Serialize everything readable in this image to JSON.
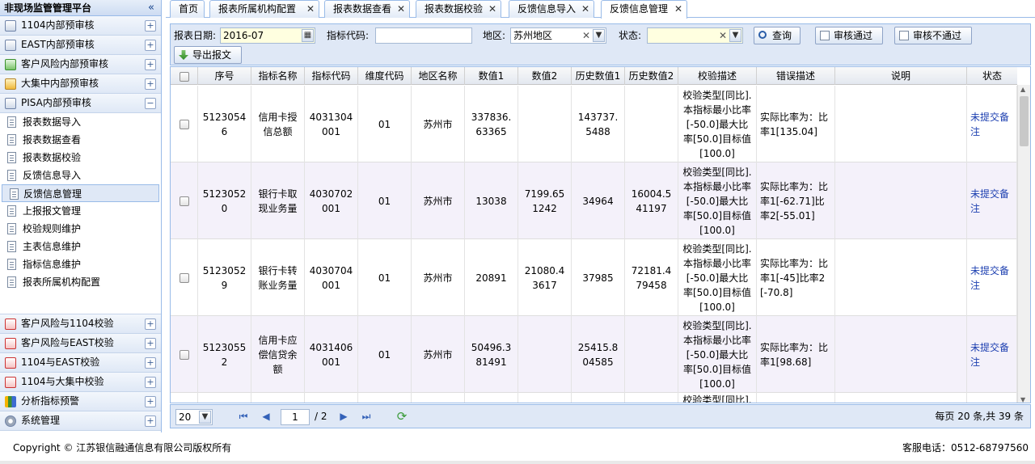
{
  "sidebar": {
    "title": "非现场监管管理平台",
    "collapse_glyph": "«",
    "groups_top": [
      {
        "label": "1104内部预审核",
        "icon": "doc-icon",
        "toggle": "+"
      },
      {
        "label": "EAST内部预审核",
        "icon": "doc-icon",
        "toggle": "+"
      },
      {
        "label": "客户风险内部预审核",
        "icon": "excel-icon",
        "toggle": "+"
      },
      {
        "label": "大集中内部预审核",
        "icon": "ribbon-icon",
        "toggle": "+"
      },
      {
        "label": "PISA内部预审核",
        "icon": "doc-icon",
        "toggle": "−"
      }
    ],
    "items": [
      {
        "label": "报表数据导入"
      },
      {
        "label": "报表数据查看"
      },
      {
        "label": "报表数据校验"
      },
      {
        "label": "反馈信息导入"
      },
      {
        "label": "反馈信息管理"
      },
      {
        "label": "上报报文管理"
      },
      {
        "label": "校验规则维护"
      },
      {
        "label": "主表信息维护"
      },
      {
        "label": "指标信息维护"
      },
      {
        "label": "报表所属机构配置"
      }
    ],
    "groups_bottom": [
      {
        "label": "客户风险与1104校验",
        "toggle": "+"
      },
      {
        "label": "客户风险与EAST校验",
        "toggle": "+"
      },
      {
        "label": "1104与EAST校验",
        "toggle": "+"
      },
      {
        "label": "1104与大集中校验",
        "toggle": "+"
      },
      {
        "label": "分析指标预警",
        "toggle": "+"
      },
      {
        "label": "系统管理",
        "toggle": "+"
      }
    ]
  },
  "tabs": [
    "首页",
    "报表所属机构配置",
    "报表数据查看",
    "报表数据校验",
    "反馈信息导入",
    "反馈信息管理"
  ],
  "tab_close": "✕",
  "filters": {
    "date_label": "报表日期:",
    "date_value": "2016-07",
    "code_label": "指标代码:",
    "code_value": "",
    "region_label": "地区:",
    "region_value": "苏州地区",
    "status_label": "状态:",
    "status_value": "",
    "clear_glyph": "✕",
    "dropdown_glyph": "▼",
    "calendar_glyph": "▦"
  },
  "buttons": {
    "query": "查询",
    "approve": "审核通过",
    "reject": "审核不通过",
    "export": "导出报文"
  },
  "columns": [
    "序号",
    "指标名称",
    "指标代码",
    "维度代码",
    "地区名称",
    "数值1",
    "数值2",
    "历史数值1",
    "历史数值2",
    "校验描述",
    "错误描述",
    "说明",
    "状态"
  ],
  "rows": [
    {
      "id": "51230546",
      "name": "信用卡授信总额",
      "code": "4031304001",
      "dim": "01",
      "region": "苏州市",
      "v1": "337836.63365",
      "v2": "",
      "h1": "143737.5488",
      "h2": "",
      "check": "校验类型[同比].本指标最小比率[-50.0]最大比率[50.0]目标值[100.0]",
      "error": "实际比率为：比率1[135.04]",
      "note": "",
      "status": "未提交备注"
    },
    {
      "id": "51230520",
      "name": "银行卡取现业务量",
      "code": "4030702001",
      "dim": "01",
      "region": "苏州市",
      "v1": "13038",
      "v2": "7199.651242",
      "h1": "34964",
      "h2": "16004.541197",
      "check": "校验类型[同比].本指标最小比率[-50.0]最大比率[50.0]目标值[100.0]",
      "error": "实际比率为：比率1[-62.71]比率2[-55.01]",
      "note": "",
      "status": "未提交备注"
    },
    {
      "id": "51230529",
      "name": "银行卡转账业务量",
      "code": "4030704001",
      "dim": "01",
      "region": "苏州市",
      "v1": "20891",
      "v2": "21080.43617",
      "h1": "37985",
      "h2": "72181.479458",
      "check": "校验类型[同比].本指标最小比率[-50.0]最大比率[50.0]目标值[100.0]",
      "error": "实际比率为：比率1[-45]比率2[-70.8]",
      "note": "",
      "status": "未提交备注"
    },
    {
      "id": "51230552",
      "name": "信用卡应偿信贷余额",
      "code": "4031406001",
      "dim": "01",
      "region": "苏州市",
      "v1": "50496.381491",
      "v2": "",
      "h1": "25415.804585",
      "h2": "",
      "check": "校验类型[同比].本指标最小比率[-50.0]最大比率[50.0]目标值[100.0]",
      "error": "实际比率为：比率1[98.68]",
      "note": "",
      "status": "未提交备注"
    },
    {
      "id": "",
      "name": "",
      "code": "",
      "dim": "",
      "region": "",
      "v1": "",
      "v2": "",
      "h1": "",
      "h2": "",
      "check": "校验类型[同比].",
      "error": "",
      "note": "",
      "status": ""
    }
  ],
  "pager": {
    "page_size": "20",
    "current_page": "1",
    "total_pages": "/ 2",
    "summary": "每页 20 条,共 39 条"
  },
  "footer": {
    "copyright": "Copyright © 江苏银信融通信息有限公司版权所有",
    "hotline": "客服电话：0512-68797560"
  }
}
